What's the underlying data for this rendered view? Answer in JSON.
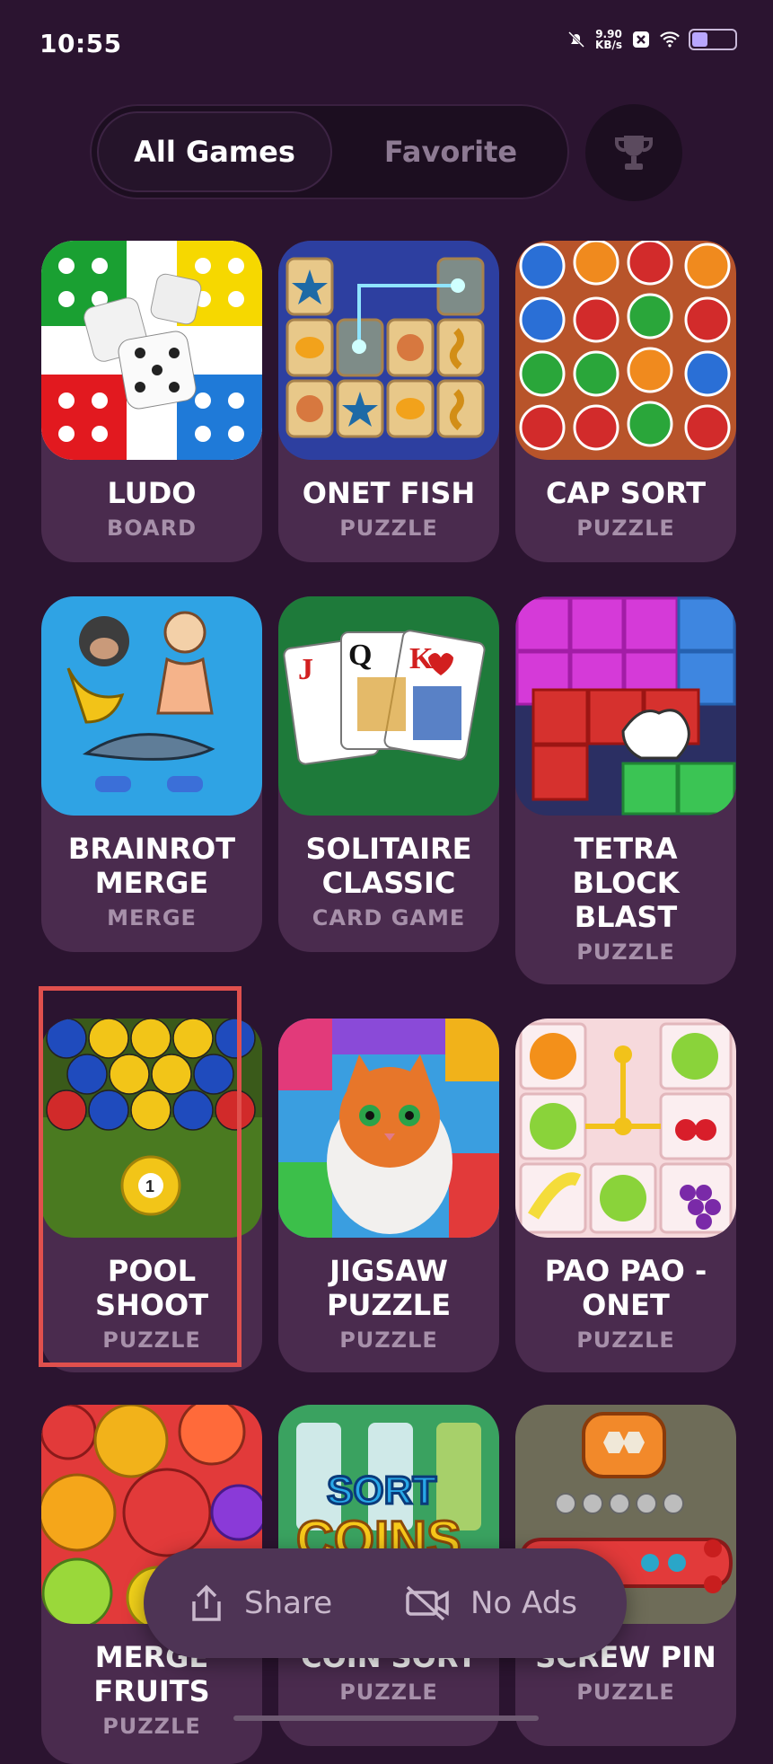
{
  "status_bar": {
    "time": "10:55",
    "net_speed_value": "9.90",
    "net_speed_unit": "KB/s",
    "icons": [
      "bell-muted-icon",
      "close-box-icon",
      "wifi-icon",
      "battery-icon"
    ]
  },
  "tabs": {
    "all_games": "All Games",
    "favorite": "Favorite",
    "active": "All Games"
  },
  "games": [
    {
      "title_lines": [
        "LUDO"
      ],
      "genre": "BOARD"
    },
    {
      "title_lines": [
        "ONET FISH"
      ],
      "genre": "PUZZLE"
    },
    {
      "title_lines": [
        "CAP SORT"
      ],
      "genre": "PUZZLE"
    },
    {
      "title_lines": [
        "BRAINROT",
        "MERGE"
      ],
      "genre": "MERGE"
    },
    {
      "title_lines": [
        "SOLITAIRE",
        "CLASSIC"
      ],
      "genre": "CARD GAME"
    },
    {
      "title_lines": [
        "TETRA",
        "BLOCK",
        "BLAST"
      ],
      "genre": "PUZZLE"
    },
    {
      "title_lines": [
        "POOL",
        "SHOOT"
      ],
      "genre": "PUZZLE"
    },
    {
      "title_lines": [
        "JIGSAW",
        "PUZZLE"
      ],
      "genre": "PUZZLE"
    },
    {
      "title_lines": [
        "PAO PAO -",
        "ONET"
      ],
      "genre": "PUZZLE"
    },
    {
      "title_lines": [
        "MERGE",
        "FRUITS"
      ],
      "genre": "PUZZLE"
    },
    {
      "title_lines": [
        "COIN SORT"
      ],
      "genre": "PUZZLE"
    },
    {
      "title_lines": [
        "SCREW PIN"
      ],
      "genre": "PUZZLE"
    }
  ],
  "bottom_bar": {
    "share_label": "Share",
    "no_ads_label": "No Ads"
  },
  "colors": {
    "background": "#2b1430",
    "card": "#4a2b4e",
    "genre_text": "#a790aa",
    "highlight": "#e0504d"
  }
}
